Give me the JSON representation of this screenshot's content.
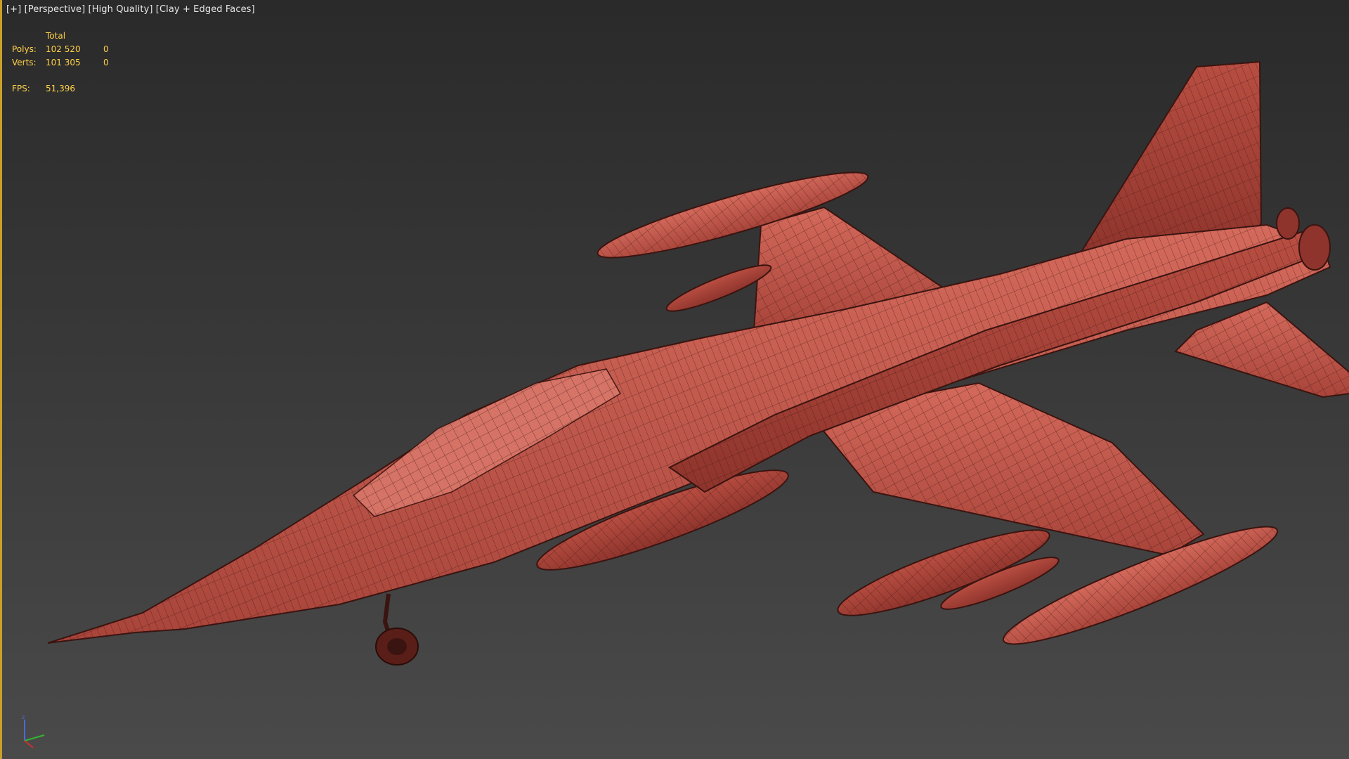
{
  "viewport": {
    "labels": [
      "[+]",
      "[Perspective]",
      "[High Quality]",
      "[Clay + Edged Faces]"
    ],
    "stats": {
      "header": "Total",
      "polys_label": "Polys:",
      "polys_total": "102 520",
      "polys_selected": "0",
      "verts_label": "Verts:",
      "verts_total": "101 305",
      "verts_selected": "0",
      "fps_label": "FPS:",
      "fps_value": "51,396"
    },
    "model": {
      "name_icon": "jet-aircraft-model",
      "clay_color": "#c45a4c",
      "edge_color": "#3a1410"
    },
    "gizmo": {
      "x_color": "#c83232",
      "y_color": "#32b432",
      "z_color": "#4a6adc"
    },
    "accent_border_color": "#c8a02a"
  }
}
